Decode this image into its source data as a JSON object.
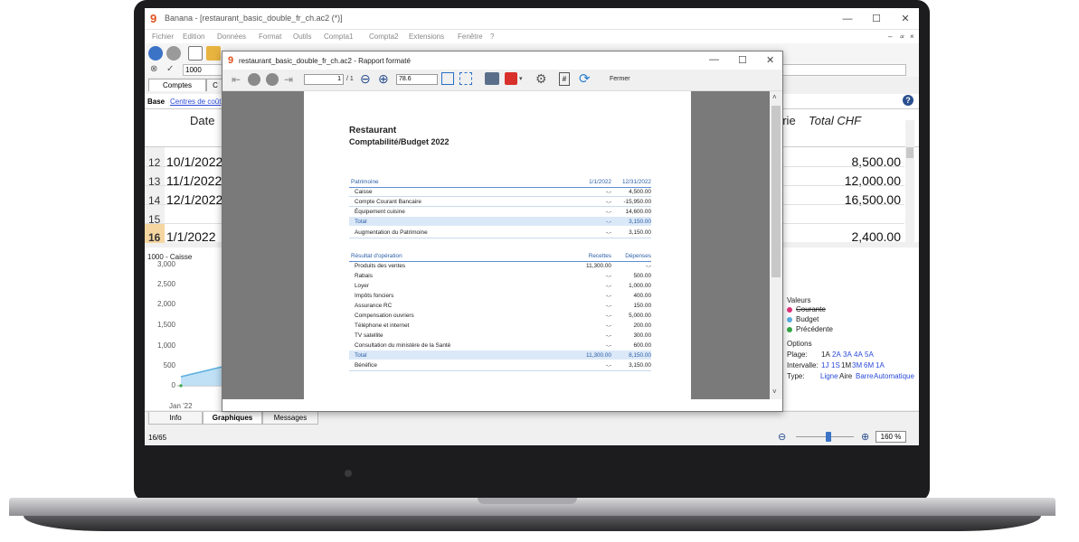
{
  "app": {
    "window_title": "Banana - [restaurant_basic_double_fr_ch.ac2 (*)]",
    "menu": [
      "Fichier",
      "Edition",
      "Données",
      "Format",
      "Outils",
      "Compta1",
      "Compta2",
      "Extensions",
      "Fenêtre",
      "?"
    ],
    "entry_value": "1000",
    "tabs": [
      "Comptes",
      "C"
    ],
    "base_label": "Base",
    "base_link": "Centres de coût",
    "grid": {
      "col_date": "Date",
      "col_categorie": "orie",
      "col_total": "Total CHF",
      "rows": [
        {
          "num": "12",
          "date": "10/1/2022",
          "total": "8,500.00"
        },
        {
          "num": "13",
          "date": "11/1/2022",
          "total": "12,000.00"
        },
        {
          "num": "14",
          "date": "12/1/2022",
          "total": "16,500.00"
        },
        {
          "num": "15",
          "date": "",
          "total": ""
        },
        {
          "num": "16",
          "date": "1/1/2022",
          "total": "2,400.00"
        }
      ]
    },
    "chart": {
      "title": "1000 - Caisse",
      "y_ticks": [
        "3,000",
        "2,500",
        "2,000",
        "1,500",
        "1,000",
        "500",
        "0"
      ],
      "x_label": "Jan '22",
      "legend_title": "Valeurs",
      "legend": [
        {
          "label": "Courante",
          "color": "#e0337a",
          "strike": true
        },
        {
          "label": "Budget",
          "color": "#5aaee0"
        },
        {
          "label": "Précédente",
          "color": "#35a846"
        }
      ],
      "options_title": "Options",
      "plage_label": "Plage:",
      "plage_values": [
        "1A",
        "2A",
        "3A",
        "4A",
        "5A"
      ],
      "intervalle_label": "Intervalle:",
      "intervalle_values": [
        "1J",
        "1S",
        "1M",
        "3M",
        "6M",
        "1A"
      ],
      "type_label": "Type:",
      "type_values": [
        "Ligne",
        "Aire",
        "Barre",
        "Automatique"
      ]
    },
    "bottom_tabs": [
      "Info",
      "Graphiques",
      "Messages"
    ],
    "status_left": "16/65",
    "zoom": "160 %"
  },
  "report": {
    "title": "restaurant_basic_double_fr_ch.ac2 - Rapport formaté",
    "page_input": "1",
    "page_total": "/ 1",
    "zoom_value": "78.6",
    "close_label": "Fermer",
    "company": "Restaurant",
    "subtitle": "Comptabilité/Budget 2022",
    "patrimoine": {
      "header": "Patrimoine",
      "col1": "1/1/2022",
      "col2": "12/31/2022",
      "rows": [
        {
          "label": "Caisse",
          "v1": "-.-",
          "v2": "4,500.00"
        },
        {
          "label": "Compte Courant Bancaire",
          "v1": "-.-",
          "v2": "-15,950.00"
        },
        {
          "label": "Équipement cuisine",
          "v1": "-.-",
          "v2": "14,600.00"
        }
      ],
      "total_label": "Total",
      "total_v1": "-.-",
      "total_v2": "3,150.00",
      "aug_label": "Augmentation du Patrimoine",
      "aug_v1": "-.-",
      "aug_v2": "3,150.00"
    },
    "resultat": {
      "header": "Résultat d'opération",
      "col1": "Recettes",
      "col2": "Dépenses",
      "rows": [
        {
          "label": "Produits des ventes",
          "v1": "11,300.00",
          "v2": "-.-"
        },
        {
          "label": "Rabais",
          "v1": "-.-",
          "v2": "500.00"
        },
        {
          "label": "Loyer",
          "v1": "-.-",
          "v2": "1,000.00"
        },
        {
          "label": "Impôts fonciers",
          "v1": "-.-",
          "v2": "400.00"
        },
        {
          "label": "Assurance RC",
          "v1": "-.-",
          "v2": "150.00"
        },
        {
          "label": "Compensation ouvriers",
          "v1": "-.-",
          "v2": "5,000.00"
        },
        {
          "label": "Téléphone et internet",
          "v1": "-.-",
          "v2": "200.00"
        },
        {
          "label": "TV satellite",
          "v1": "-.-",
          "v2": "300.00"
        },
        {
          "label": "Consultation du ministère de la Santé",
          "v1": "-.-",
          "v2": "600.00"
        }
      ],
      "total_label": "Total",
      "total_v1": "11,300.00",
      "total_v2": "8,150.00",
      "benefice_label": "Bénéfice",
      "benefice_v1": "-.-",
      "benefice_v2": "3,150.00"
    }
  }
}
